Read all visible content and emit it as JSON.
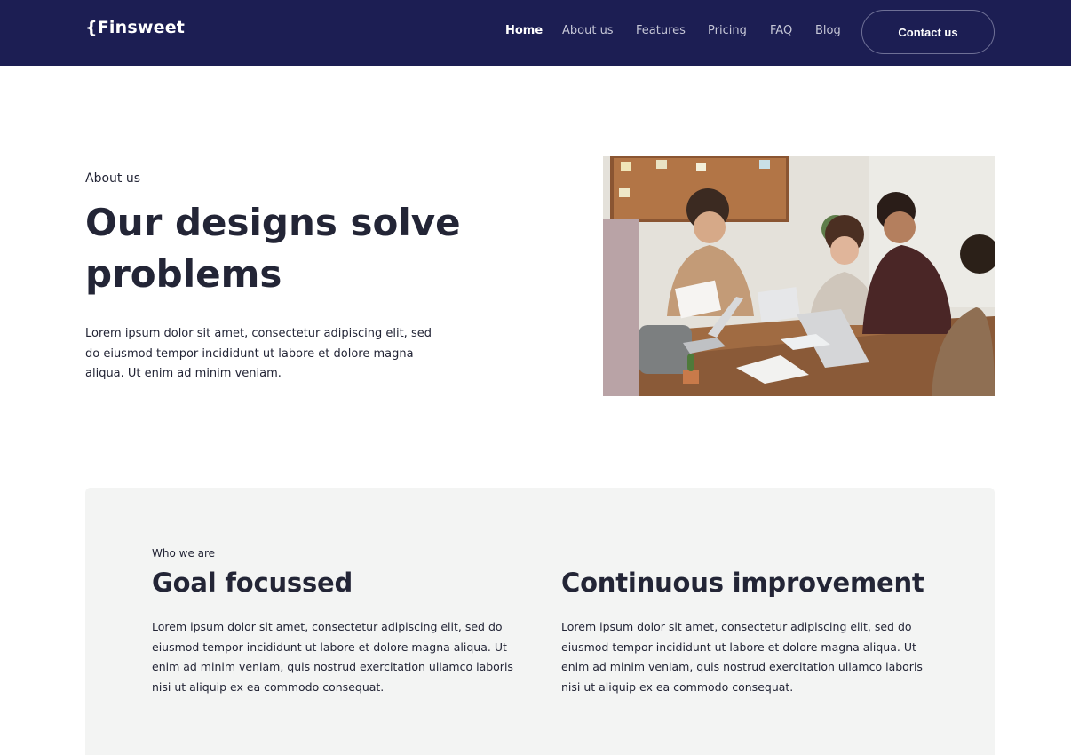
{
  "nav": {
    "logo": "{Finsweet",
    "links": [
      "Home",
      "About us",
      "Features",
      "Pricing",
      "FAQ",
      "Blog"
    ],
    "active": "Home",
    "cta": "Contact us"
  },
  "hero": {
    "eyebrow": "About us",
    "title": "Our designs solve problems",
    "body": "Lorem ipsum dolor sit amet, consectetur adipiscing elit, sed do eiusmod tempor incididunt ut labore et dolore magna aliqua. Ut enim ad minim veniam."
  },
  "who": {
    "eyebrow": "Who we are",
    "columns": [
      {
        "title": "Goal focussed",
        "body": "Lorem ipsum dolor sit amet, consectetur adipiscing elit, sed do eiusmod tempor incididunt ut labore et dolore magna aliqua. Ut enim ad minim veniam, quis nostrud exercitation ullamco laboris nisi ut aliquip ex ea commodo consequat."
      },
      {
        "title": "Continuous improvement",
        "body": "Lorem ipsum dolor sit amet, consectetur adipiscing elit, sed do eiusmod tempor incididunt ut labore et dolore magna aliqua. Ut enim ad minim veniam, quis nostrud exercitation ullamco laboris nisi ut aliquip ex ea commodo consequat."
      }
    ]
  },
  "colors": {
    "navy": "#1c1e53",
    "text": "#232536",
    "panel": "#f3f4f3"
  }
}
